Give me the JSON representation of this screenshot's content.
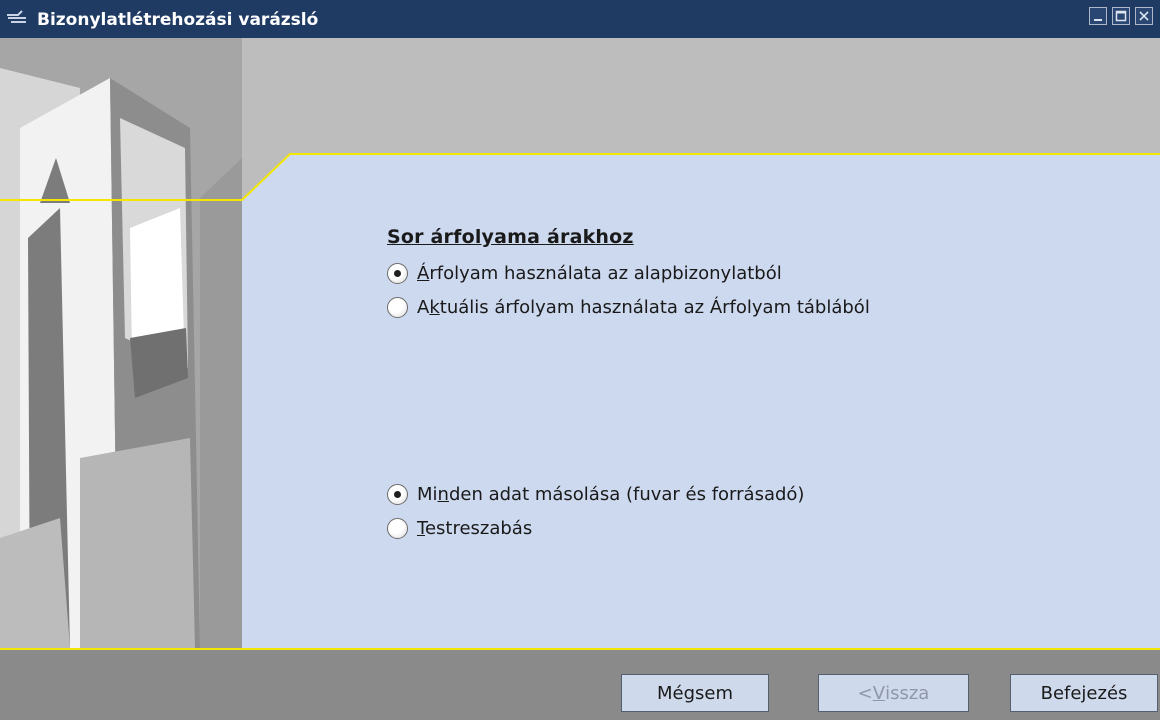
{
  "window": {
    "title": "Bizonylatlétrehozási varázsló",
    "minimize_icon": "minimize-icon",
    "maximize_icon": "maximize-icon",
    "close_icon": "close-icon"
  },
  "colors": {
    "titlebar": "#1f3b64",
    "panel": "#cdd9ef",
    "accent_line": "#f3e600",
    "footer": "#8a8a8a"
  },
  "main": {
    "section_title": "Sor árfolyama árakhoz",
    "rate_options": [
      {
        "prefix": "",
        "mnemonic": "Á",
        "suffix": "rfolyam használata az alapbizonylatból",
        "checked": true
      },
      {
        "prefix": "A",
        "mnemonic": "k",
        "suffix": "tuális árfolyam használata az Árfolyam táblából",
        "checked": false
      }
    ],
    "copy_options": [
      {
        "prefix": "Mi",
        "mnemonic": "n",
        "suffix": "den adat másolása (fuvar és forrásadó)",
        "checked": true
      },
      {
        "prefix": "",
        "mnemonic": "T",
        "suffix": "estreszabás",
        "checked": false
      }
    ]
  },
  "buttons": {
    "cancel": "Mégsem",
    "back_prefix": "< ",
    "back_mnemonic": "V",
    "back_suffix": "issza",
    "finish": "Befejezés"
  }
}
